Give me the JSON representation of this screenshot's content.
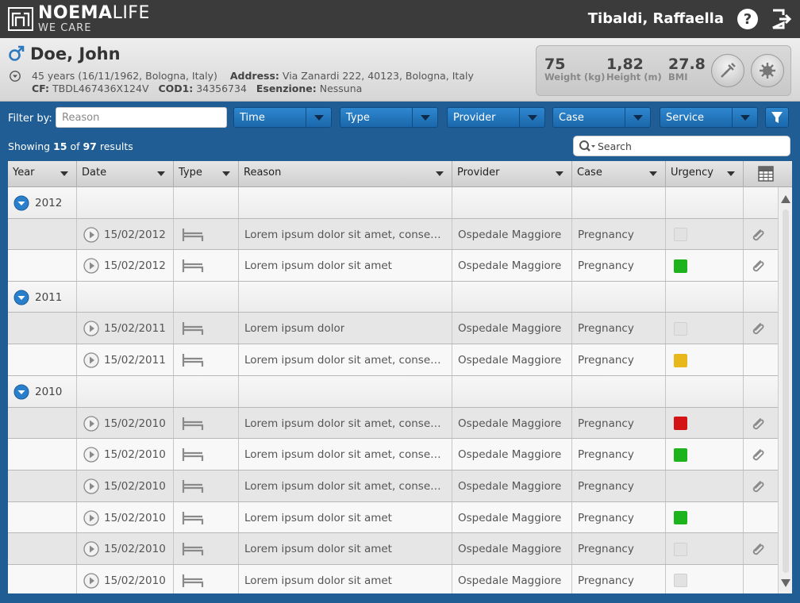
{
  "app": {
    "brand": "NOEMA",
    "brand_suffix": "LIFE",
    "tagline": "WE CARE",
    "user_name": "Tibaldi, Raffaella",
    "icons": {
      "help": "help-icon",
      "logout": "logout-icon"
    }
  },
  "patient": {
    "name": "Doe, John",
    "sex_icon": "male-icon",
    "age_birth": "45 years (16/11/1962, Bologna, Italy)",
    "address_label": "Address:",
    "address": "Via Zanardi 222, 40123, Bologna, Italy",
    "cf_label": "CF:",
    "cf": "TBDL467436X124V",
    "cod1_label": "COD1:",
    "cod1": "34356734",
    "esenzione_label": "Esenzione:",
    "esenzione": "Nessuna",
    "vitals": {
      "weight": {
        "value": "75",
        "unit": "Weight (kg)"
      },
      "height": {
        "value": "1,82",
        "unit": "Height (m)"
      },
      "bmi": {
        "value": "27.8",
        "unit": "BMI"
      }
    }
  },
  "filters": {
    "label": "Filter by:",
    "reason_placeholder": "Reason",
    "dropdowns": [
      "Time",
      "Type",
      "Provider",
      "Case",
      "Service"
    ]
  },
  "results": {
    "prefix": "Showing",
    "shown": "15",
    "of": "of",
    "total": "97",
    "suffix": "results"
  },
  "search": {
    "placeholder": "Search"
  },
  "table": {
    "columns": [
      "Year",
      "Date",
      "Type",
      "Reason",
      "Provider",
      "Case",
      "Urgency"
    ],
    "groups": [
      {
        "year": "2012",
        "rows": [
          {
            "date": "15/02/2012",
            "reason": "Lorem ipsum dolor sit amet, consectetur",
            "provider": "Ospedale Maggiore",
            "case": "Pregnancy",
            "urgency": "none",
            "attachment": true
          },
          {
            "date": "15/02/2012",
            "reason": "Lorem ipsum dolor sit amet",
            "provider": "Ospedale Maggiore",
            "case": "Pregnancy",
            "urgency": "green",
            "attachment": true
          }
        ]
      },
      {
        "year": "2011",
        "rows": [
          {
            "date": "15/02/2011",
            "reason": "Lorem ipsum dolor",
            "provider": "Ospedale Maggiore",
            "case": "Pregnancy",
            "urgency": "none",
            "attachment": true
          },
          {
            "date": "15/02/2011",
            "reason": "Lorem ipsum dolor sit amet, consectetur",
            "provider": "Ospedale Maggiore",
            "case": "Pregnancy",
            "urgency": "yellow",
            "attachment": false
          }
        ]
      },
      {
        "year": "2010",
        "rows": [
          {
            "date": "15/02/2010",
            "reason": "Lorem ipsum dolor sit amet, consectetur",
            "provider": "Ospedale Maggiore",
            "case": "Pregnancy",
            "urgency": "red",
            "attachment": true
          },
          {
            "date": "15/02/2010",
            "reason": "Lorem ipsum dolor sit amet, consectetur",
            "provider": "Ospedale Maggiore",
            "case": "Pregnancy",
            "urgency": "green",
            "attachment": true
          },
          {
            "date": "15/02/2010",
            "reason": "Lorem ipsum dolor sit amet, consectetur",
            "provider": "Ospedale Maggiore",
            "case": "Pregnancy",
            "urgency": "empty",
            "attachment": true
          },
          {
            "date": "15/02/2010",
            "reason": "Lorem ipsum dolor sit amet",
            "provider": "Ospedale Maggiore",
            "case": "Pregnancy",
            "urgency": "green",
            "attachment": false
          },
          {
            "date": "15/02/2010",
            "reason": "Lorem ipsum dolor sit amet",
            "provider": "Ospedale Maggiore",
            "case": "Pregnancy",
            "urgency": "none",
            "attachment": true
          },
          {
            "date": "15/02/2010",
            "reason": "Lorem ipsum dolor sit amet",
            "provider": "Ospedale Maggiore",
            "case": "Pregnancy",
            "urgency": "none",
            "attachment": false
          }
        ]
      }
    ],
    "urgency_colors": {
      "green": "#1db31d",
      "yellow": "#e8b81a",
      "red": "#d41414",
      "none": "#e2e2e2"
    },
    "row_icons": {
      "open": "play-icon",
      "type": "bed-icon",
      "attachment": "paperclip-icon",
      "group_toggle": "chevron-down-icon"
    }
  },
  "theme": {
    "accent": "#1f5d94",
    "topbar": "#3b3b3b"
  }
}
